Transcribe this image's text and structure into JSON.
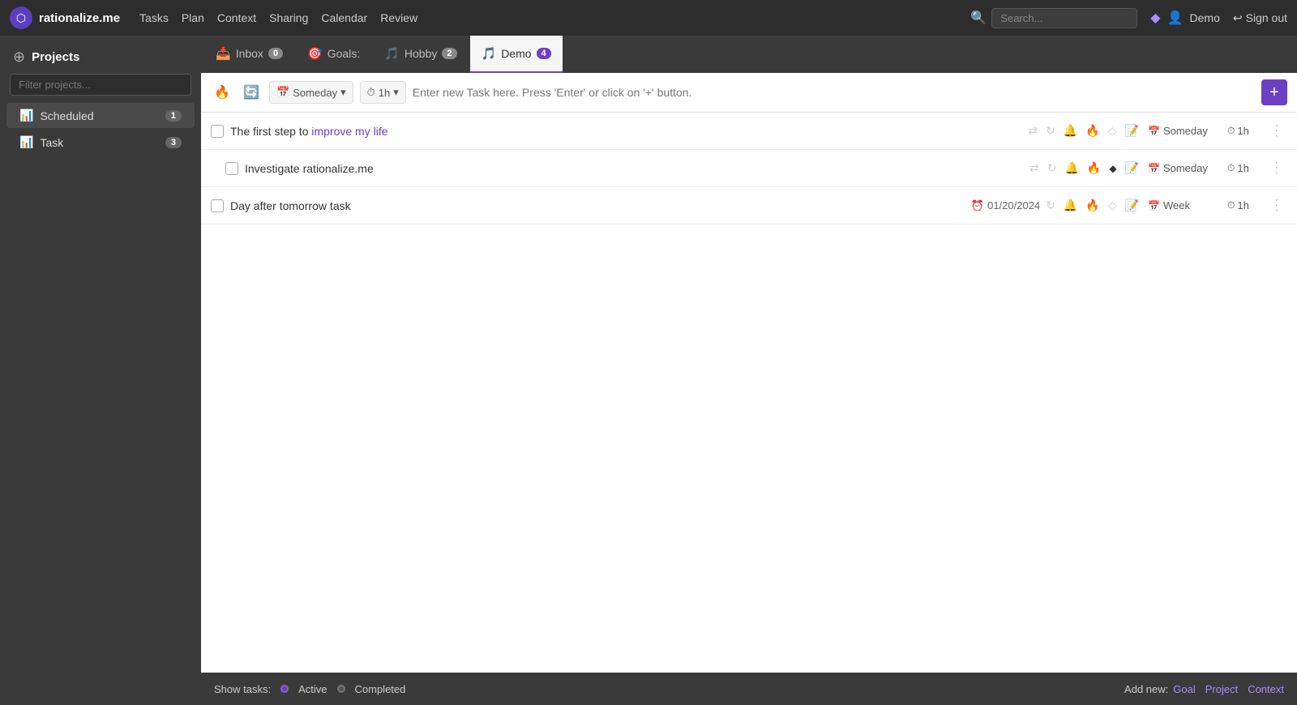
{
  "app": {
    "logo_text": "rationalize.me",
    "logo_icon": "⬡"
  },
  "topnav": {
    "links": [
      "Tasks",
      "Plan",
      "Context",
      "Sharing",
      "Calendar",
      "Review"
    ],
    "search_placeholder": "Search...",
    "user_name": "Demo",
    "signout_label": "Sign out"
  },
  "sidebar": {
    "title": "Projects",
    "filter_placeholder": "Filter projects...",
    "items": [
      {
        "label": "Scheduled",
        "badge": "1",
        "icon": "📊"
      },
      {
        "label": "Task",
        "badge": "3",
        "icon": "📊"
      }
    ]
  },
  "tabs": [
    {
      "label": "Inbox",
      "badge": "0",
      "icon": "📥",
      "active": false
    },
    {
      "label": "Goals:",
      "badge": "",
      "icon": "🎯",
      "active": false
    },
    {
      "label": "Hobby",
      "badge": "2",
      "icon": "🎵",
      "active": false
    },
    {
      "label": "Demo",
      "badge": "4",
      "icon": "🎵",
      "active": true
    }
  ],
  "new_task": {
    "placeholder": "Enter new Task here. Press 'Enter' or click on '+' button.",
    "schedule": "Someday",
    "duration": "1h",
    "add_btn": "+"
  },
  "tasks": [
    {
      "id": 1,
      "label_parts": [
        {
          "text": "The first step to ",
          "highlight": false
        },
        {
          "text": "improve my life",
          "highlight": true
        }
      ],
      "date": "",
      "schedule": "Someday",
      "duration": "1h",
      "fire": false,
      "diamond": false,
      "checked": false
    },
    {
      "id": 2,
      "label_parts": [
        {
          "text": "Investigate rationalize.me",
          "highlight": false
        }
      ],
      "date": "",
      "schedule": "Someday",
      "duration": "1h",
      "fire": false,
      "diamond": true,
      "checked": false
    },
    {
      "id": 3,
      "label_parts": [
        {
          "text": "Day after tomorrow task",
          "highlight": false
        }
      ],
      "date": "01/20/2024",
      "schedule": "Week",
      "duration": "1h",
      "fire": true,
      "diamond": false,
      "checked": false
    }
  ],
  "footer": {
    "show_tasks_label": "Show tasks:",
    "active_label": "Active",
    "completed_label": "Completed",
    "add_new_label": "Add new:",
    "goal_link": "Goal",
    "project_link": "Project",
    "context_link": "Context"
  }
}
